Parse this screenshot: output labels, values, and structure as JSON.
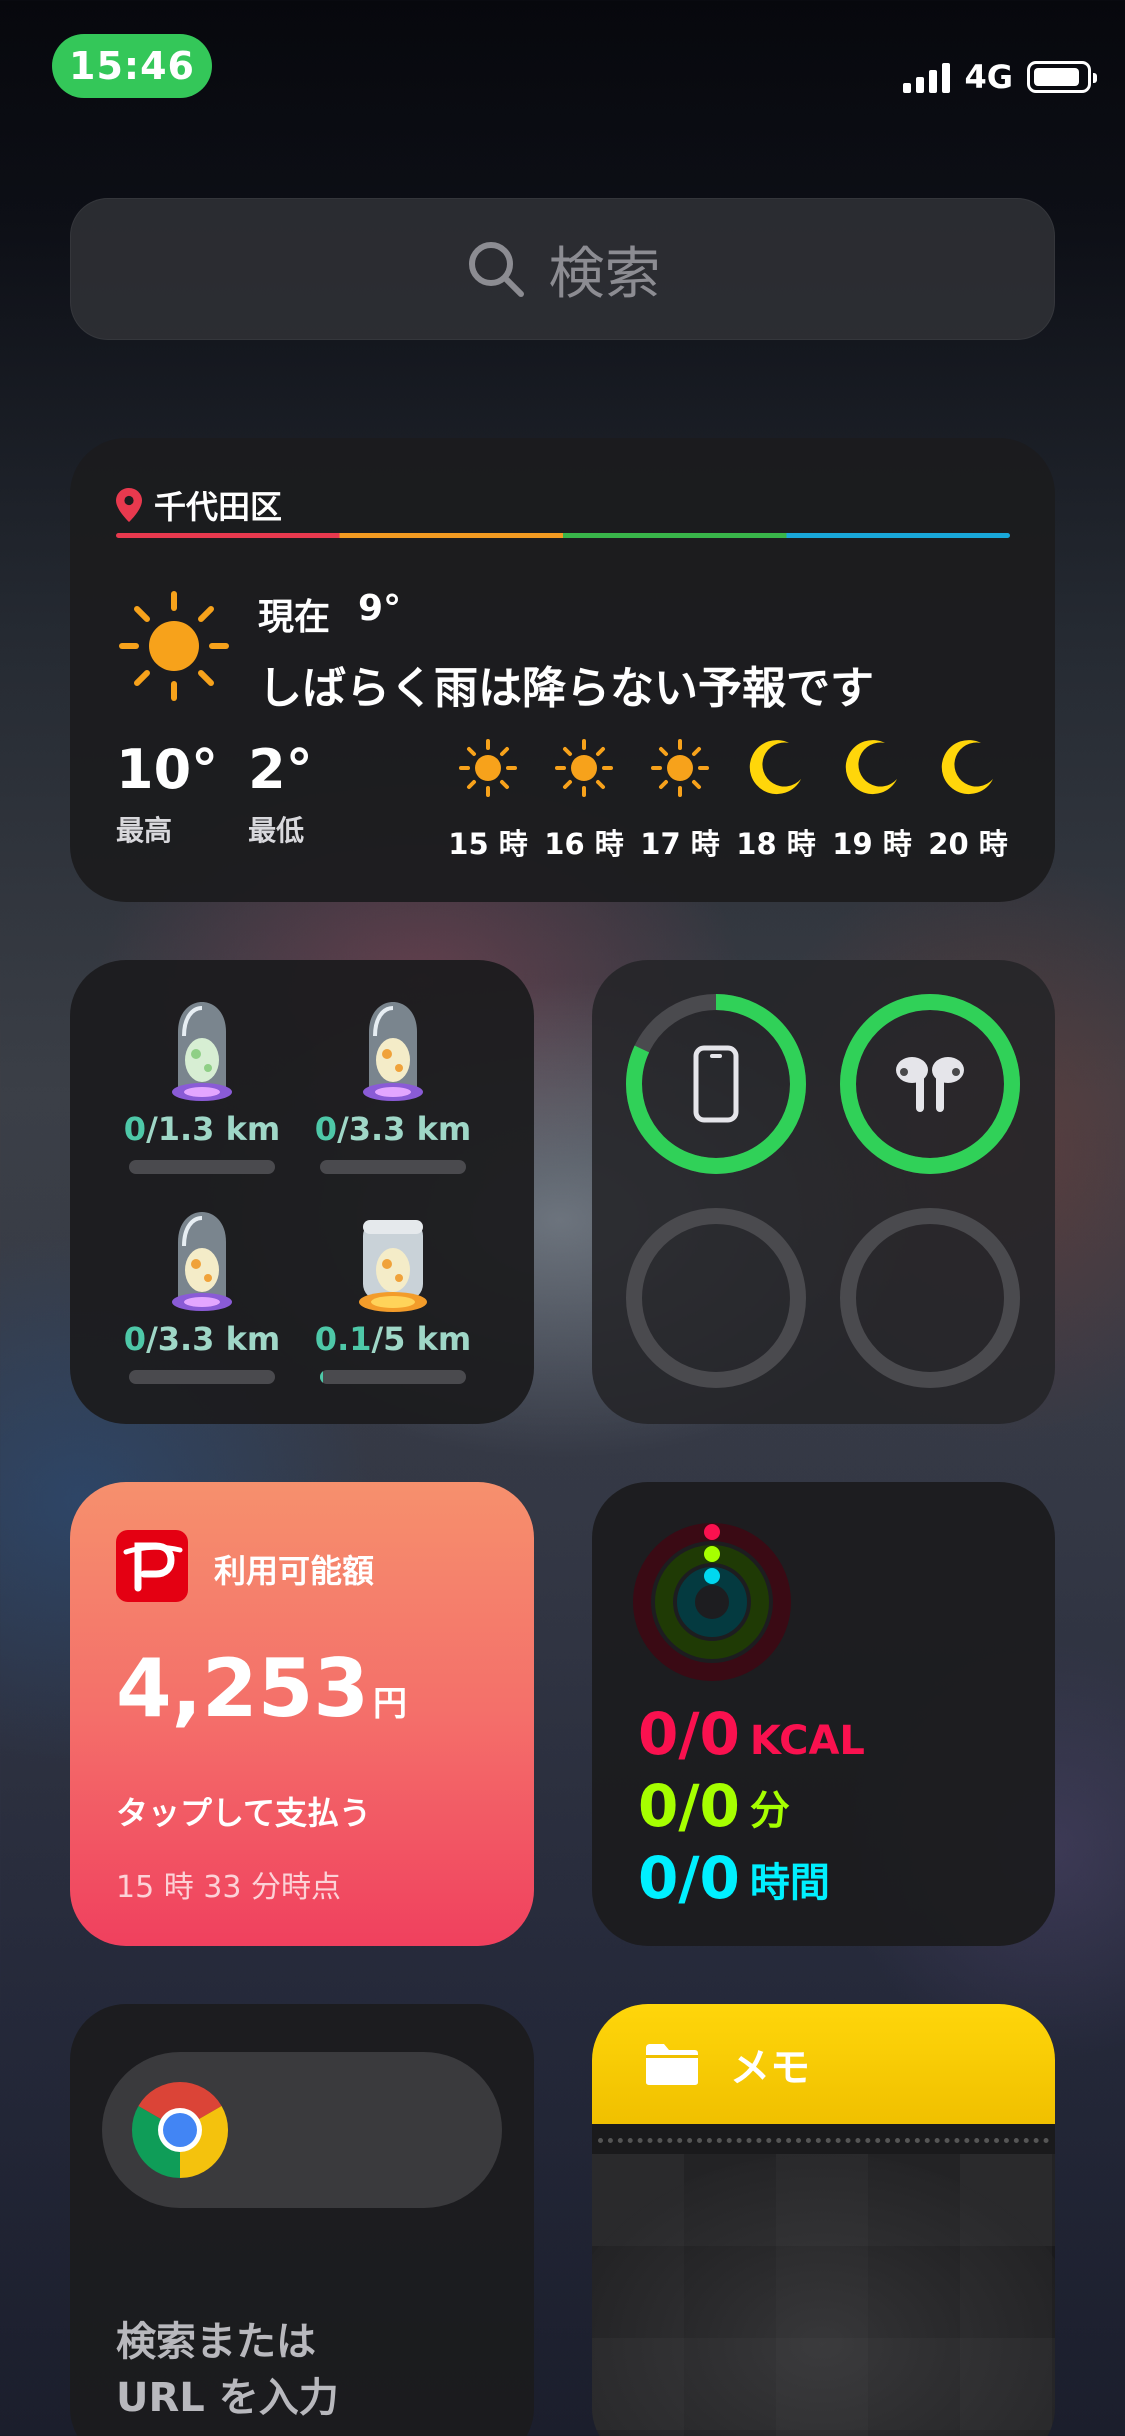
{
  "status_bar": {
    "time": "15:46",
    "network": "4G",
    "signal_bars": 4,
    "battery_level": 0.9
  },
  "search": {
    "placeholder": "検索",
    "icon": "search-icon"
  },
  "weather": {
    "location": "千代田区",
    "current_label": "現在",
    "current_temp": "9°",
    "message": "しばらく雨は降らない予報です",
    "high": "10°",
    "high_label": "最高",
    "low": "2°",
    "low_label": "最低",
    "hourly": [
      {
        "time": "15 時",
        "icon": "sun-icon"
      },
      {
        "time": "16 時",
        "icon": "sun-icon"
      },
      {
        "time": "17 時",
        "icon": "sun-icon"
      },
      {
        "time": "18 時",
        "icon": "moon-icon"
      },
      {
        "time": "19 時",
        "icon": "moon-icon"
      },
      {
        "time": "20 時",
        "icon": "moon-icon"
      }
    ],
    "colors": {
      "sun": "#f7a21b",
      "moon": "#ffd60a",
      "pin": "#e8394e"
    }
  },
  "eggs": [
    {
      "walked": "0",
      "total": "1.3 km",
      "progress": 0,
      "incubator": "glass-incubator-icon"
    },
    {
      "walked": "0",
      "total": "3.3 km",
      "progress": 0,
      "incubator": "glass-incubator-icon"
    },
    {
      "walked": "0",
      "total": "3.3 km",
      "progress": 0,
      "incubator": "glass-incubator-icon"
    },
    {
      "walked": "0.1",
      "total": "5 km",
      "progress": 0.02,
      "incubator": "super-incubator-icon"
    }
  ],
  "batteries": [
    {
      "device": "iphone-icon",
      "level": 0.82
    },
    {
      "device": "airpods-icon",
      "level": 1.0
    },
    {
      "device": "empty-slot",
      "level": 0
    },
    {
      "device": "empty-slot",
      "level": 0
    }
  ],
  "paypay": {
    "title": "利用可能額",
    "amount": "4,253",
    "unit": "円",
    "action": "タップして支払う",
    "updated": "15 時 33 分時点"
  },
  "activity": {
    "move": {
      "value": "0/0",
      "unit": "KCAL",
      "color": "#fa114f"
    },
    "exercise": {
      "value": "0/0",
      "unit": "分",
      "color": "#a6ff00"
    },
    "stand": {
      "value": "0/0",
      "unit": "時間",
      "color": "#00f0ff"
    }
  },
  "chrome": {
    "text": "検索または\nURL を入力"
  },
  "memo": {
    "title": "メモ"
  }
}
